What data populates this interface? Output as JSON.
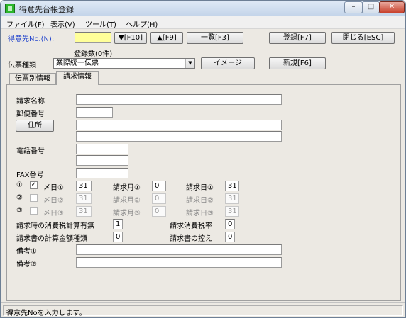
{
  "window": {
    "title": "得意先台帳登録",
    "min_label": "–",
    "max_label": "□",
    "close_label": "✕"
  },
  "menu": [
    "ファイル(F)",
    "表示(V)",
    "ツール(T)",
    "ヘルプ(H)"
  ],
  "header": {
    "customer_no_label": "得意先No.(N):",
    "customer_no_value": "",
    "next_button": "▼[F10]",
    "prev_button": "▲[F9]",
    "list_button": "一覧[F3]",
    "register_button": "登録[F7]",
    "close_button": "閉じる[ESC]",
    "registered_count": "登録数(0件)",
    "slip_type_label": "伝票種類",
    "slip_type_value": "業際統一伝票",
    "image_button": "イメージ",
    "new_button": "新規[F6]"
  },
  "tabs": [
    "伝票別情報",
    "請求情報"
  ],
  "form": {
    "billing_name_label": "請求名称",
    "billing_name_value": "",
    "postal_code_label": "郵便番号",
    "postal_code_value": "",
    "address_button": "住所",
    "address_line1": "",
    "address_line2": "",
    "phone_label": "電話番号",
    "phone_1": "",
    "phone_2": "",
    "fax_label": "FAX番号",
    "fax_value": "",
    "closing_rows": [
      {
        "num": "①",
        "checked": true,
        "check_mark": "✓",
        "day_label": "〆日①",
        "day_value": "31",
        "month_label": "請求月①",
        "month_value": "0",
        "bill_day_label": "請求日①",
        "bill_day_value": "31",
        "enabled": true
      },
      {
        "num": "②",
        "checked": false,
        "check_mark": "",
        "day_label": "〆日②",
        "day_value": "31",
        "month_label": "請求月②",
        "month_value": "0",
        "bill_day_label": "請求日②",
        "bill_day_value": "31",
        "enabled": false
      },
      {
        "num": "③",
        "checked": false,
        "check_mark": "",
        "day_label": "〆日③",
        "day_value": "31",
        "month_label": "請求月③",
        "month_value": "0",
        "bill_day_label": "請求日③",
        "bill_day_value": "31",
        "enabled": false
      }
    ],
    "tax_calc_label": "請求時の消費税計算有無",
    "tax_calc_value": "1",
    "tax_rate_label": "請求消費税率",
    "tax_rate_value": "0",
    "amount_type_label": "請求書の計算金額種類",
    "amount_type_value": "0",
    "copy_label": "請求書の控え",
    "copy_value": "0",
    "remarks1_label": "備考①",
    "remarks1_value": "",
    "remarks2_label": "備考②",
    "remarks2_value": ""
  },
  "status": {
    "text": "得意先Noを入力します。"
  }
}
